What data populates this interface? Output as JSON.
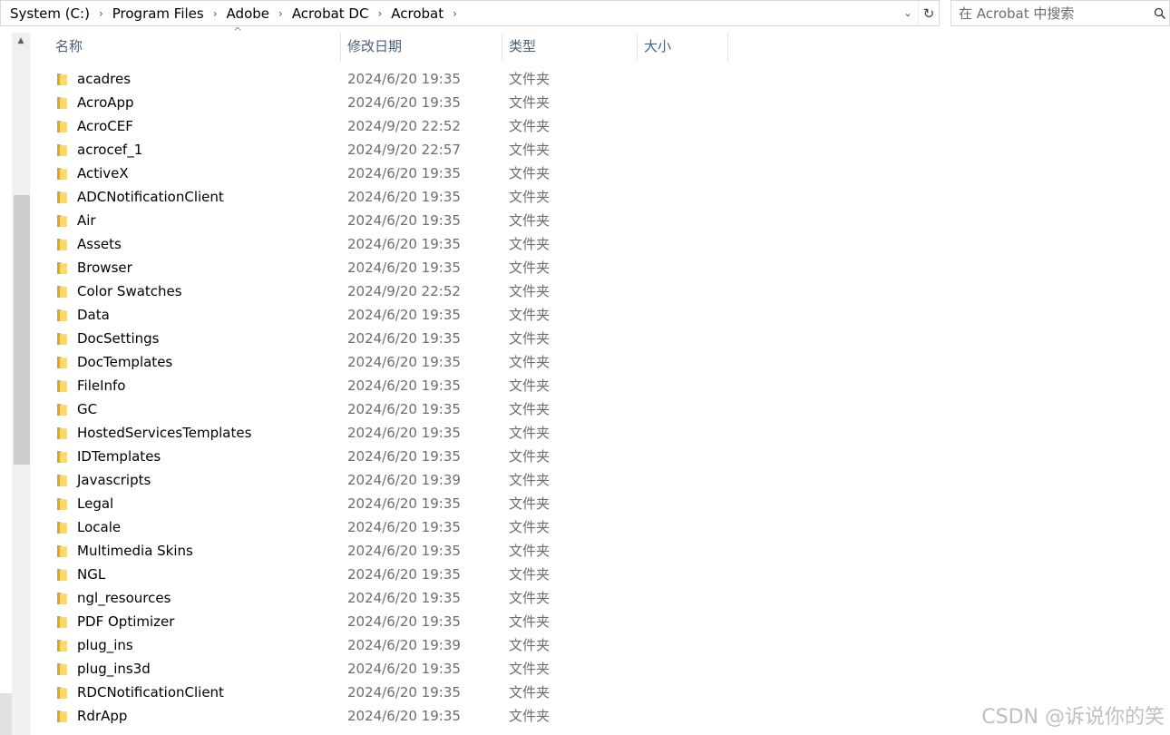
{
  "address_bar": {
    "breadcrumbs": [
      "System (C:)",
      "Program Files",
      "Adobe",
      "Acrobat DC",
      "Acrobat"
    ],
    "separator": "›",
    "dropdown_glyph": "⌄",
    "refresh_glyph": "↻"
  },
  "search": {
    "placeholder": "在 Acrobat 中搜索",
    "icon": "search-icon"
  },
  "columns": {
    "name": "名称",
    "date": "修改日期",
    "type": "类型",
    "size": "大小",
    "sort_indicator": "^"
  },
  "scrollbar": {
    "up_glyph": "▲"
  },
  "folder_color": "#f4c542",
  "files": [
    {
      "name": "acadres",
      "date": "2024/6/20 19:35",
      "type": "文件夹"
    },
    {
      "name": "AcroApp",
      "date": "2024/6/20 19:35",
      "type": "文件夹"
    },
    {
      "name": "AcroCEF",
      "date": "2024/9/20 22:52",
      "type": "文件夹"
    },
    {
      "name": "acrocef_1",
      "date": "2024/9/20 22:57",
      "type": "文件夹"
    },
    {
      "name": "ActiveX",
      "date": "2024/6/20 19:35",
      "type": "文件夹"
    },
    {
      "name": "ADCNotificationClient",
      "date": "2024/6/20 19:35",
      "type": "文件夹"
    },
    {
      "name": "Air",
      "date": "2024/6/20 19:35",
      "type": "文件夹"
    },
    {
      "name": "Assets",
      "date": "2024/6/20 19:35",
      "type": "文件夹"
    },
    {
      "name": "Browser",
      "date": "2024/6/20 19:35",
      "type": "文件夹"
    },
    {
      "name": "Color Swatches",
      "date": "2024/9/20 22:52",
      "type": "文件夹"
    },
    {
      "name": "Data",
      "date": "2024/6/20 19:35",
      "type": "文件夹"
    },
    {
      "name": "DocSettings",
      "date": "2024/6/20 19:35",
      "type": "文件夹"
    },
    {
      "name": "DocTemplates",
      "date": "2024/6/20 19:35",
      "type": "文件夹"
    },
    {
      "name": "FileInfo",
      "date": "2024/6/20 19:35",
      "type": "文件夹"
    },
    {
      "name": "GC",
      "date": "2024/6/20 19:35",
      "type": "文件夹"
    },
    {
      "name": "HostedServicesTemplates",
      "date": "2024/6/20 19:35",
      "type": "文件夹"
    },
    {
      "name": "IDTemplates",
      "date": "2024/6/20 19:35",
      "type": "文件夹"
    },
    {
      "name": "Javascripts",
      "date": "2024/6/20 19:39",
      "type": "文件夹"
    },
    {
      "name": "Legal",
      "date": "2024/6/20 19:35",
      "type": "文件夹"
    },
    {
      "name": "Locale",
      "date": "2024/6/20 19:35",
      "type": "文件夹"
    },
    {
      "name": "Multimedia Skins",
      "date": "2024/6/20 19:35",
      "type": "文件夹"
    },
    {
      "name": "NGL",
      "date": "2024/6/20 19:35",
      "type": "文件夹"
    },
    {
      "name": "ngl_resources",
      "date": "2024/6/20 19:35",
      "type": "文件夹"
    },
    {
      "name": "PDF Optimizer",
      "date": "2024/6/20 19:35",
      "type": "文件夹"
    },
    {
      "name": "plug_ins",
      "date": "2024/6/20 19:39",
      "type": "文件夹"
    },
    {
      "name": "plug_ins3d",
      "date": "2024/6/20 19:35",
      "type": "文件夹"
    },
    {
      "name": "RDCNotificationClient",
      "date": "2024/6/20 19:35",
      "type": "文件夹"
    },
    {
      "name": "RdrApp",
      "date": "2024/6/20 19:35",
      "type": "文件夹"
    }
  ],
  "watermark": "CSDN @诉说你的笑"
}
